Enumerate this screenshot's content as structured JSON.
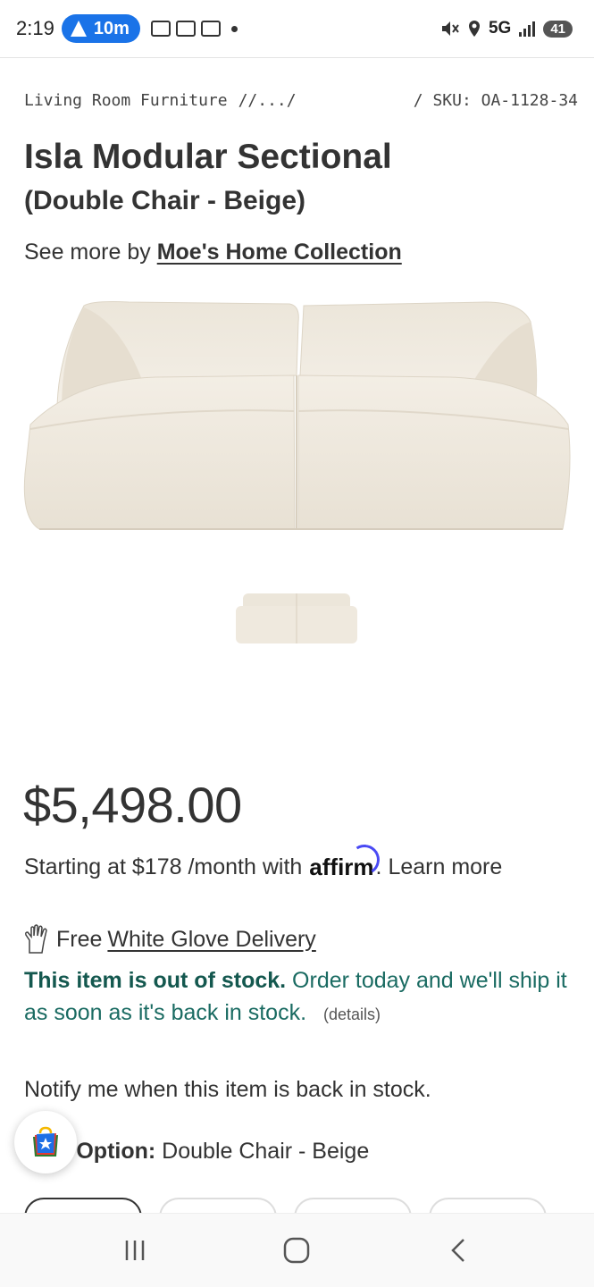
{
  "status_bar": {
    "time": "2:19",
    "nav_eta": "10m",
    "network": "5G",
    "battery": "41"
  },
  "breadcrumb": {
    "category": "Living Room Furniture",
    "ellipsis": "/.../",
    "sku": "/ SKU: OA-1128-34"
  },
  "product": {
    "title": "Isla Modular Sectional",
    "subtitle": "(Double Chair - Beige)",
    "see_more_prefix": "See more by",
    "brand": "Moe's Home Collection",
    "price": "$5,498.00",
    "financing_prefix": "Starting at $178 /month with",
    "affirm": "affirm",
    "learn_more": ". Learn more",
    "delivery_prefix": "Free",
    "delivery_link": "White Glove Delivery",
    "stock_bold": "This item is out of stock.",
    "stock_rest": "Order today and we'll ship it as soon as it's back in stock.",
    "details": "(details)",
    "notify": "Notify me when this item is back in stock.",
    "selected_label": "cted Option:",
    "selected_value": "Double Chair - Beige"
  },
  "colors": {
    "stock_green": "#1a6b62",
    "affirm_blue": "#4a4af4",
    "nav_blue": "#1a73e8"
  }
}
